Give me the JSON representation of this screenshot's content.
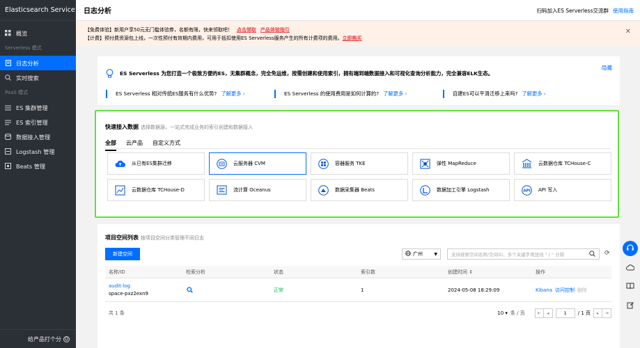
{
  "sidebar": {
    "brand": "Elasticsearch Service",
    "overview": "概览",
    "group_serverless": "Serverless 模式",
    "log_analysis": "日志分析",
    "realtime_search": "实时搜索",
    "group_paas": "PaaS 模式",
    "es_cluster": "ES 集群管理",
    "es_index": "ES 索引管理",
    "data_ingest": "数据接入管理",
    "logstash": "Logstash 管理",
    "beats": "Beats 管理",
    "feedback": "给产品打个分"
  },
  "header": {
    "title": "日志分析",
    "scan_text": "扫码加入ES Serverless交流群",
    "guide_link": "使用指南"
  },
  "notice": {
    "line1": "【免费体验】新用户享50元无门槛体验券，名额有限，快来领取吧！",
    "line1_link1": "点击领取",
    "line1_link2": "产品体验指引",
    "line2": "【计费】预付费资源包上线，一次性预付有效期内费用，可用于抵扣使用ES Serverless服务产生的所有计费项的费用。",
    "line2_link": "立即购买"
  },
  "intro": {
    "headline": "ES Serverless 为您打造一个极致方便的ES，无集群概念，完全免运维，按需创建和使用索引，拥有端到端数据接入和可视化查询分析能力，完全兼容ELK生态。",
    "hide": "隐藏",
    "links": [
      {
        "text": "ES Serverless 相对传统ES服务有什么优势?",
        "more": "了解更多 ›"
      },
      {
        "text": "ES Serverless 的使用费用是如何计算的?",
        "more": "了解更多 ›"
      },
      {
        "text": "自建ES可以平滑迁移上来吗?",
        "more": "了解更多 ›"
      }
    ]
  },
  "quick": {
    "title": "快速接入数据",
    "subtitle": "选择数据源，一站式完成业务的索引创建和数据接入",
    "tabs": [
      "全部",
      "云产品",
      "自定义方式"
    ],
    "tiles": [
      "从已有ES集群迁移",
      "云服务器 CVM",
      "容器服务 TKE",
      "弹性 MapReduce",
      "云数据仓库 TCHouse-C",
      "云数据仓库 TCHouse-D",
      "流计算 Oceanus",
      "数据采集器 Beats",
      "数据加工引擎 Logstash",
      "API 写入"
    ]
  },
  "projects": {
    "title": "项目空间列表",
    "subtitle": "按项目空间分类管理不同日志",
    "new_button": "新建空间",
    "region": "广州",
    "search_placeholder": "支持搜索空间名称/空间ID，多个关键字用竖线 \" | \" 分隔",
    "columns": [
      "名称/ID",
      "检索分析",
      "状态",
      "索引数",
      "创建时间 ⇕",
      "操作"
    ],
    "rows": [
      {
        "name": "audit-log",
        "id": "space-pxz2exn9",
        "status": "正常",
        "index_count": "1",
        "created": "2024-05-08 18:29:09",
        "op_kibana": "Kibana",
        "op_access": "访问控制",
        "op_delete": "删除"
      }
    ],
    "total": "共 1 条",
    "page_size": "10",
    "page_size_unit": "条 / 页",
    "page_num": "1",
    "page_total": "/ 1 页"
  },
  "colors": {
    "sidebar_bg": "#2b2f36",
    "accent": "#006eff",
    "notice_bg": "#fff1e8",
    "highlight_border": "#5fe13b"
  }
}
